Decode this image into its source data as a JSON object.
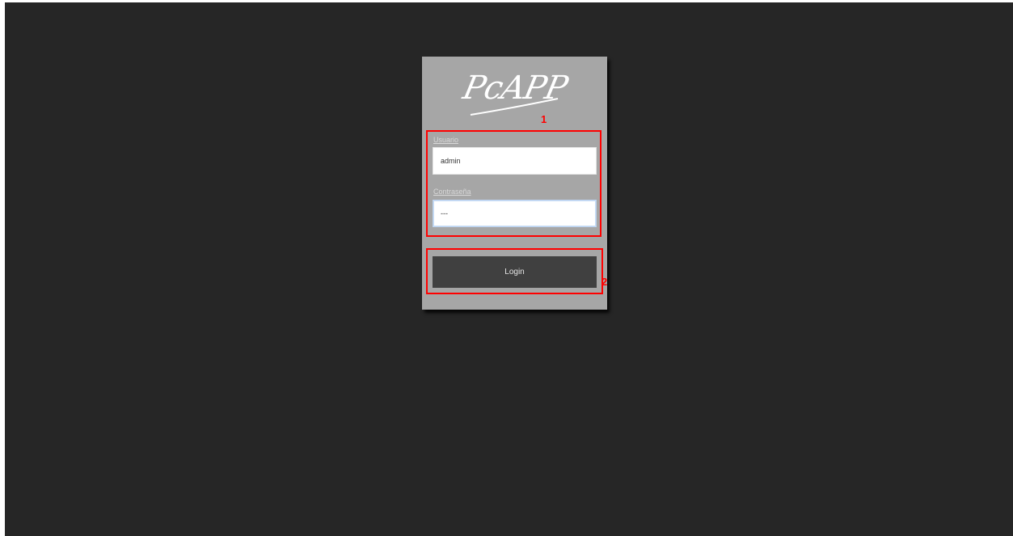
{
  "app": {
    "logo_text": "PcAPP"
  },
  "login_form": {
    "username_label": "Usuario",
    "username_value": "admin",
    "password_label": "Contraseña",
    "password_value": "---",
    "login_button_label": "Login"
  },
  "annotations": {
    "box1_label": "1",
    "box2_label": "2"
  },
  "colors": {
    "background": "#262626",
    "card": "#a6a6a6",
    "button": "#404040",
    "annotation": "#ff0000"
  }
}
